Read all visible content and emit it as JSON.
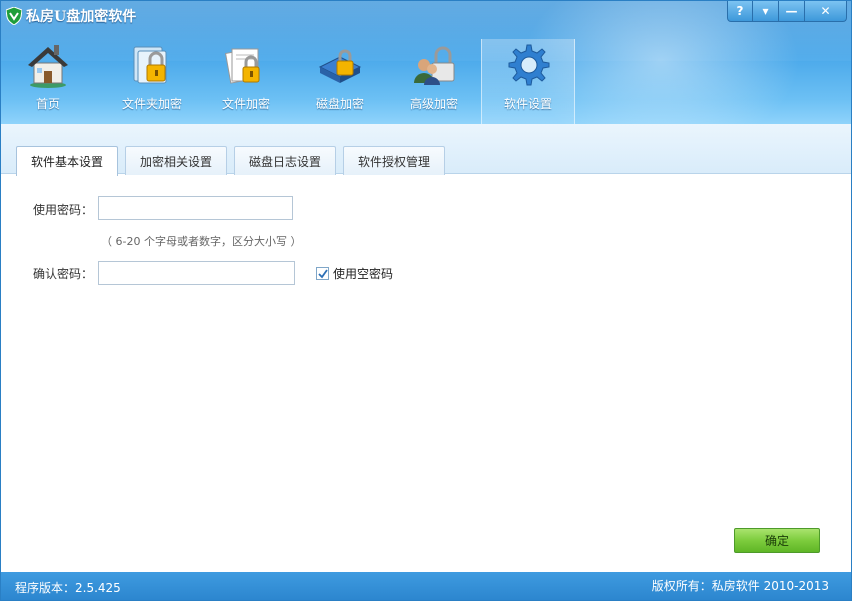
{
  "window": {
    "title": "私房U盘加密软件",
    "controls": {
      "help": "?",
      "menu": "▾",
      "minimize": "—",
      "close": "✕"
    }
  },
  "toolbar": [
    {
      "label": "首页",
      "icon": "home-icon"
    },
    {
      "label": "文件夹加密",
      "icon": "folder-lock-icon"
    },
    {
      "label": "文件加密",
      "icon": "file-lock-icon"
    },
    {
      "label": "磁盘加密",
      "icon": "disk-lock-icon"
    },
    {
      "label": "高级加密",
      "icon": "users-lock-icon"
    },
    {
      "label": "软件设置",
      "icon": "gear-icon",
      "active": true
    }
  ],
  "tabs": [
    {
      "label": "软件基本设置",
      "active": true
    },
    {
      "label": "加密相关设置"
    },
    {
      "label": "磁盘日志设置"
    },
    {
      "label": "软件授权管理"
    }
  ],
  "form": {
    "password_label": "使用密码：",
    "password_value": "",
    "hint": "（ 6-20 个字母或者数字，区分大小写 ）",
    "confirm_label": "确认密码：",
    "confirm_value": "",
    "empty_password_checkbox": {
      "label": "使用空密码",
      "checked": true
    }
  },
  "ok_button": "确定",
  "status": {
    "version": "程序版本：2.5.425",
    "copyright": "版权所有：私房软件 2010-2013"
  },
  "colors": {
    "header": "#4aa8ea",
    "status_bar": "#3393d8",
    "ok_button": "#7dcc3d"
  }
}
